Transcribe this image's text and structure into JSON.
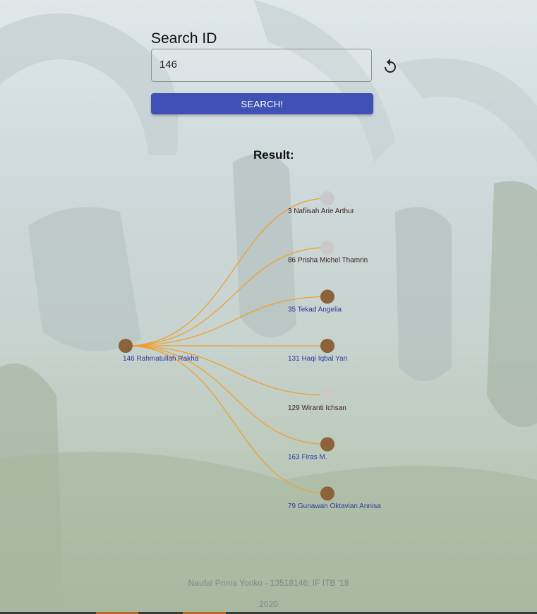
{
  "search": {
    "label": "Search ID",
    "value": "146",
    "button_label": "SEARCH!"
  },
  "result": {
    "label": "Result:"
  },
  "graph": {
    "root": {
      "label": "146 Rahmatullah Rakha",
      "color": "#8b6239",
      "text_color": "#2e3a9e"
    },
    "friends": [
      {
        "label": "3 Nafiisah Arie Arthur",
        "color": "#c8c9c8",
        "text_color": "#3a1f1f"
      },
      {
        "label": "86 Prisha Michel Thamrin",
        "color": "#c8c9c8",
        "text_color": "#3a1f1f"
      },
      {
        "label": "35 Tekad Angelia",
        "color": "#8b6239",
        "text_color": "#2e3a9e"
      },
      {
        "label": "131 Haqi Iqbal Yan",
        "color": "#8b6239",
        "text_color": "#2e3a9e"
      },
      {
        "label": "129 Wiranti Ichsan",
        "color": "#c8c9c8",
        "text_color": "#3a1f1f"
      },
      {
        "label": "163 Firas M.",
        "color": "#8b6239",
        "text_color": "#2e3a9e"
      },
      {
        "label": "79 Gunawan Oktavian Annisa",
        "color": "#8b6239",
        "text_color": "#2e3a9e"
      }
    ],
    "edge_color": "#f0a030"
  },
  "footer": {
    "credit": "Naufal Prima Yoriko - 13518146; IF ITB '18",
    "year": "2020"
  }
}
